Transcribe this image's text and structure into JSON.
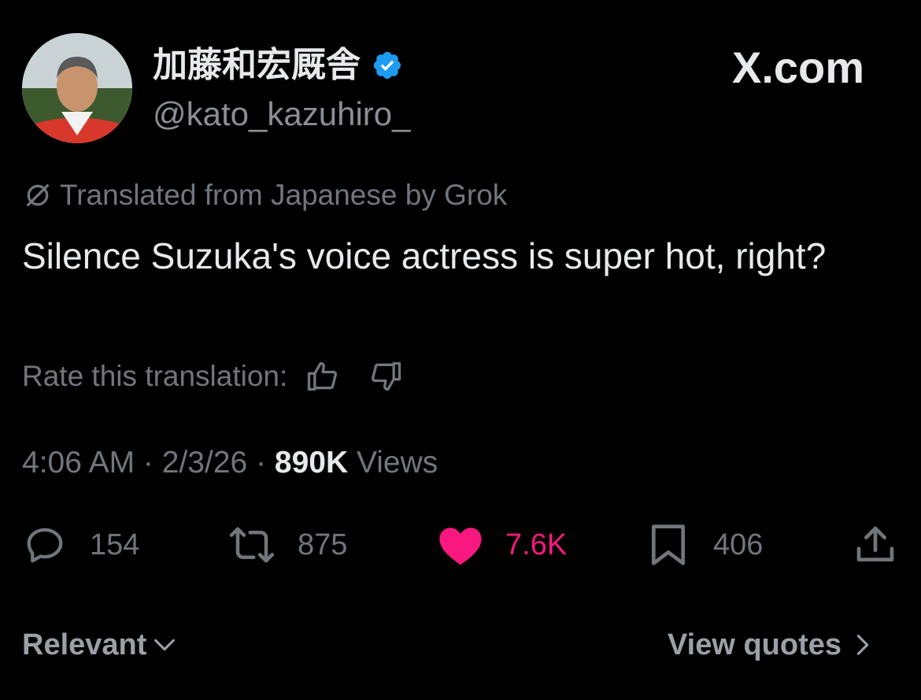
{
  "header": {
    "display_name": "加藤和宏厩舎",
    "handle": "@kato_kazuhiro_",
    "brand": "X.com"
  },
  "translation": {
    "notice": "Translated from Japanese by Grok",
    "rate_label": "Rate this translation:"
  },
  "tweet": {
    "text": "Silence Suzuka's voice actress is super hot, right?"
  },
  "meta": {
    "time": "4:06 AM",
    "sep1": " · ",
    "date": "2/3/26",
    "sep2": " · ",
    "views_count": "890K",
    "views_label": " Views"
  },
  "actions": {
    "replies": "154",
    "reposts": "875",
    "likes": "7.6K",
    "bookmarks": "406"
  },
  "footer": {
    "sort_label": "Relevant",
    "quotes_label": "View quotes"
  },
  "colors": {
    "background": "#000000",
    "like": "#f91880",
    "verified": "#1d9bf0",
    "muted": "#71767b"
  },
  "icons": [
    "verified-badge-icon",
    "translate-icon",
    "thumbs-up-icon",
    "thumbs-down-icon",
    "reply-icon",
    "repost-icon",
    "heart-icon",
    "bookmark-icon",
    "share-icon",
    "chevron-down-icon",
    "chevron-right-icon"
  ]
}
